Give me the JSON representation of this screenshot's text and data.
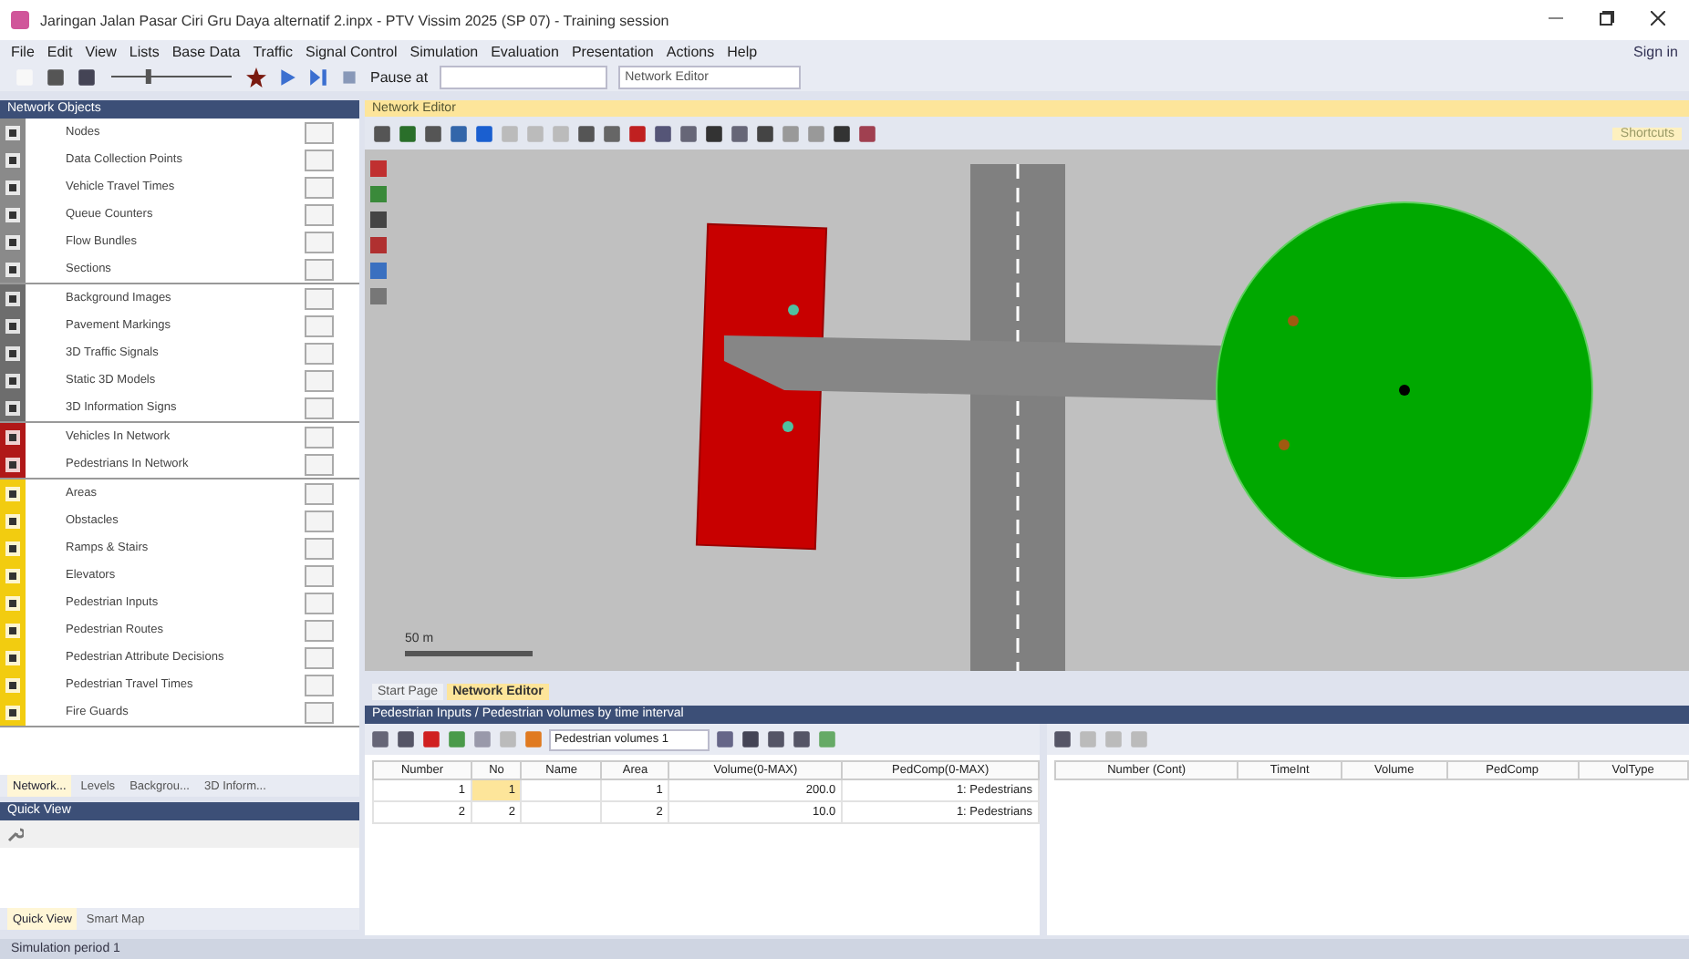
{
  "window": {
    "title": "Jaringan Jalan Pasar Ciri Gru Daya alternatif 2.inpx - PTV Vissim 2025 (SP 07) - Training session"
  },
  "menu": [
    "File",
    "Edit",
    "View",
    "Lists",
    "Base Data",
    "Traffic",
    "Signal Control",
    "Simulation",
    "Evaluation",
    "Presentation",
    "Actions",
    "Help"
  ],
  "sign_in": "Sign in",
  "toolbar": {
    "zoom": {
      "level": 0.3
    },
    "pause_label": "Pause at",
    "view_dropdown": "Network Editor"
  },
  "network_objects": {
    "title": "Network Objects",
    "groups": [
      {
        "kind": "vehicle",
        "items": [
          "Nodes",
          "Data Collection Points",
          "Vehicle Travel Times",
          "Queue Counters",
          "Flow Bundles",
          "Sections"
        ]
      },
      {
        "kind": "static",
        "items": [
          "Background Images",
          "Pavement Markings",
          "3D Traffic Signals",
          "Static 3D Models",
          "3D Information Signs"
        ]
      },
      {
        "kind": "dynamic",
        "items": [
          "Vehicles In Network",
          "Pedestrians In Network"
        ]
      },
      {
        "kind": "pedestrian",
        "items": [
          "Areas",
          "Obstacles",
          "Ramps & Stairs",
          "Elevators",
          "Pedestrian Inputs",
          "Pedestrian Routes",
          "Pedestrian Attribute Decisions",
          "Pedestrian Travel Times",
          "Fire Guards"
        ]
      }
    ],
    "tabs": [
      {
        "label": "Network...",
        "selected": true
      },
      {
        "label": "Levels",
        "selected": false
      },
      {
        "label": "Backgrou...",
        "selected": false
      },
      {
        "label": "3D Inform...",
        "selected": false
      }
    ]
  },
  "quick_view": {
    "title": "Quick View",
    "tabs": [
      {
        "label": "Quick View",
        "selected": true
      },
      {
        "label": "Smart Map",
        "selected": false
      }
    ]
  },
  "status_bar": "Simulation period 1",
  "network_editor": {
    "title": "Network Editor",
    "shortcuts": "Shortcuts",
    "scale": "50 m"
  },
  "editor_tabs": [
    {
      "label": "Start Page",
      "selected": false
    },
    {
      "label": "Network Editor",
      "selected": true
    }
  ],
  "list": {
    "title": "Pedestrian Inputs / Pedestrian volumes by time interval",
    "dropdown": "Pedestrian volumes 1",
    "columns": [
      "Number",
      "No",
      "Name",
      "Area",
      "Volume(0-MAX)",
      "PedComp(0-MAX)"
    ],
    "rows": [
      {
        "selected": true,
        "cells": [
          "1",
          "1",
          "",
          "1",
          "200.0",
          "1: Pedestrians"
        ]
      },
      {
        "selected": false,
        "cells": [
          "2",
          "2",
          "",
          "2",
          "10.0",
          "1: Pedestrians"
        ]
      }
    ],
    "detail_columns": [
      "Number (Cont)",
      "TimeInt",
      "Volume",
      "PedComp",
      "VolType"
    ]
  }
}
